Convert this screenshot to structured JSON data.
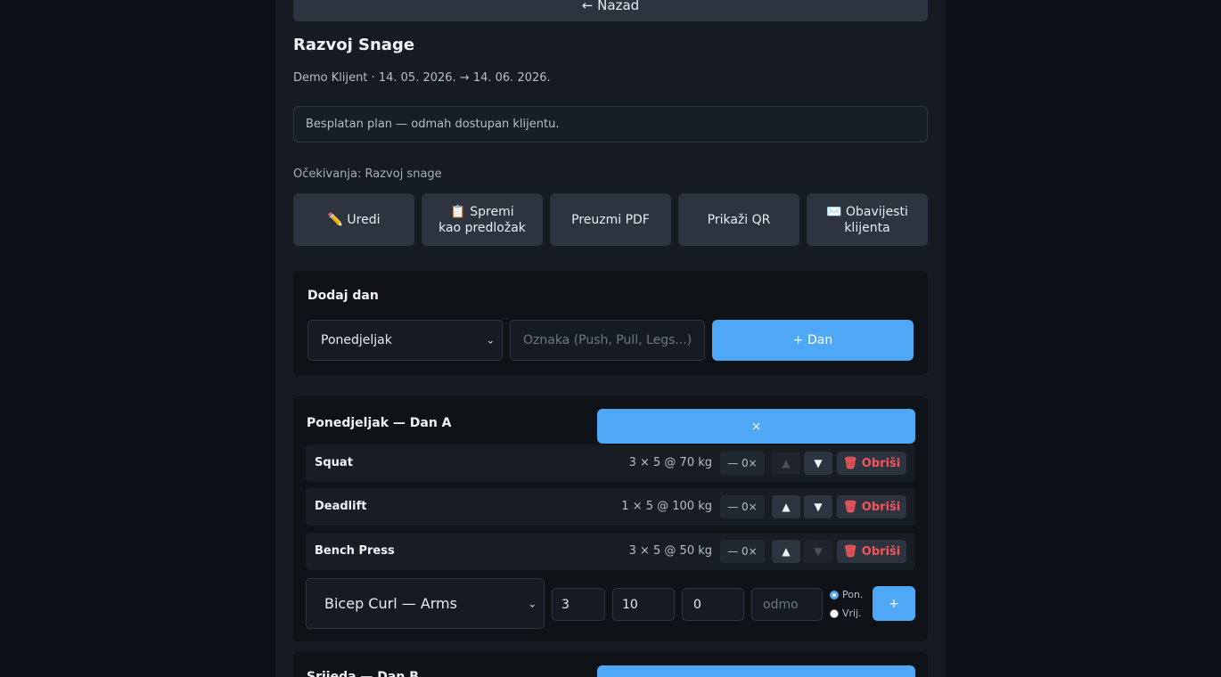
{
  "header": {
    "back_label": "← Nazad",
    "title": "Razvoj Snage",
    "subtitle": "Demo Klijent · 14. 05. 2026. → 14. 06. 2026.",
    "notice": "Besplatan plan — odmah dostupan klijentu.",
    "expectations": "Očekivanja: Razvoj snage"
  },
  "actions": {
    "edit": "✏️ Uredi",
    "save_template_line1": "📋 Spremi",
    "save_template_line2": "kao predložak",
    "download_pdf": "Preuzmi PDF",
    "show_qr": "Prikaži QR",
    "notify_line1": "✉️ Obavijesti",
    "notify_line2": "klijenta"
  },
  "add_day": {
    "title": "Dodaj dan",
    "day_select_value": "Ponedjeljak",
    "label_placeholder": "Oznaka (Push, Pull, Legs...)",
    "add_button": "+ Dan"
  },
  "day": {
    "title": "Ponedjeljak — Dan A",
    "close_label": "×",
    "exercises": [
      {
        "name": "Squat",
        "detail": "3 × 5 @ 70 kg",
        "count": "— 0×",
        "up": "▲",
        "down": "▼",
        "delete": "🗑 Obriši",
        "up_disabled": true,
        "down_disabled": false
      },
      {
        "name": "Deadlift",
        "detail": "1 × 5 @ 100 kg",
        "count": "— 0×",
        "up": "▲",
        "down": "▼",
        "delete": "🗑 Obriši",
        "up_disabled": false,
        "down_disabled": false
      },
      {
        "name": "Bench Press",
        "detail": "3 × 5 @ 50 kg",
        "count": "— 0×",
        "up": "▲",
        "down": "▼",
        "delete": "🗑 Obriši",
        "up_disabled": false,
        "down_disabled": true
      }
    ],
    "add_exercise": {
      "exercise_select_value": "Bicep Curl — Arms",
      "sets_value": "3",
      "reps_value": "10",
      "weight_value": "0",
      "rest_placeholder": "odmo",
      "radio_reps": "Pon.",
      "radio_time": "Vrij.",
      "add_button": "+"
    }
  },
  "next_day": {
    "title": "Srijeda — Dan B"
  }
}
